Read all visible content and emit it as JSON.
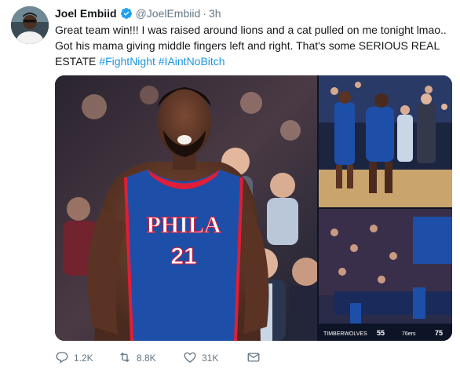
{
  "tweet": {
    "author_name": "Joel Embiid",
    "handle": "@JoelEmbiid",
    "separator": "·",
    "time": "3h",
    "text": "Great team win!!! I was raised around lions and a cat pulled on me tonight lmao.. Got his mama giving middle fingers left and right. That's some SERIOUS REAL ESTATE ",
    "hashtags": [
      "#FightNight",
      "#IAintNoBitch"
    ],
    "hashtag_color": "#1b95e0"
  },
  "media": {
    "main_photo_jersey": "PHILA",
    "main_photo_number": "21",
    "bottom_right_scoreboard": {
      "team_left": "TIMBERWOLVES",
      "score_left": "55",
      "team_right": "76ers",
      "score_right": "75"
    }
  },
  "actions": {
    "reply_count": "1.2K",
    "retweet_count": "8.8K",
    "like_count": "31K"
  },
  "icons": {
    "verified": "verified-badge-icon",
    "reply": "reply-icon",
    "retweet": "retweet-icon",
    "like": "heart-icon",
    "dm": "envelope-icon"
  },
  "colors": {
    "text": "#14171a",
    "secondary": "#657786",
    "verified": "#1da1f2",
    "sixers_blue": "#1d4fa8",
    "sixers_red": "#e01e37"
  }
}
